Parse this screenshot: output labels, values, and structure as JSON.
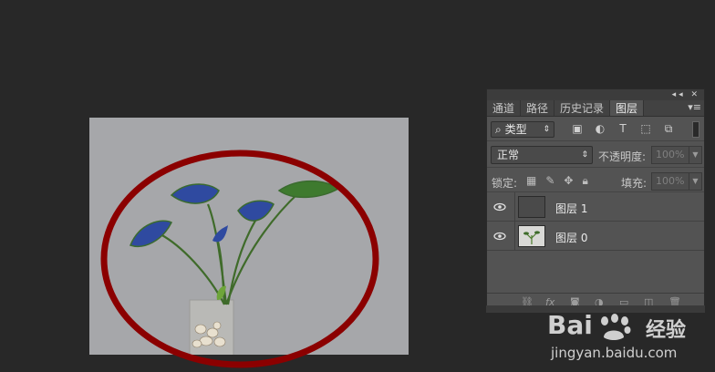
{
  "canvas": {
    "background": "#a6a7aa",
    "ellipse_color": "#8b0000"
  },
  "panel": {
    "titlebar_buttons": "◂◂ ✕",
    "tabs": [
      {
        "label": "通道"
      },
      {
        "label": "路径"
      },
      {
        "label": "历史记录"
      },
      {
        "label": "图层"
      }
    ],
    "active_tab": "图层",
    "filter": {
      "selected": "类型",
      "arrows": "⇕"
    },
    "blend_mode": "正常",
    "opacity_label": "不透明度:",
    "opacity_value": "100%",
    "lock_label": "锁定:",
    "fill_label": "填充:",
    "fill_value": "100%",
    "layers": [
      {
        "name": "图层 1",
        "thumb": "#4a4a4a"
      },
      {
        "name": "图层 0",
        "thumb": "#d9d9d6"
      }
    ]
  },
  "watermark": {
    "logo_en": "Bai",
    "logo_cn": "经验",
    "url": "jingyan.baidu.com"
  }
}
